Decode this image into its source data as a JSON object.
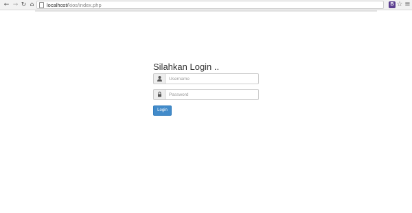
{
  "browser": {
    "back_icon": "back-arrow-icon",
    "forward_icon": "forward-arrow-icon",
    "reload_icon": "reload-icon",
    "home_icon": "home-icon",
    "url_host": "localhost/",
    "url_path": "kios/index.php",
    "extension_label": "B",
    "extension_color": "#5b3e8f",
    "bookmark_icon": "star-icon",
    "menu_icon": "hamburger-menu-icon"
  },
  "login": {
    "title": "Silahkan Login ..",
    "username": {
      "icon": "user-icon",
      "placeholder": "Username",
      "value": ""
    },
    "password": {
      "icon": "lock-icon",
      "placeholder": "Password",
      "value": ""
    },
    "submit_label": "Login",
    "submit_color": "#428bca"
  }
}
